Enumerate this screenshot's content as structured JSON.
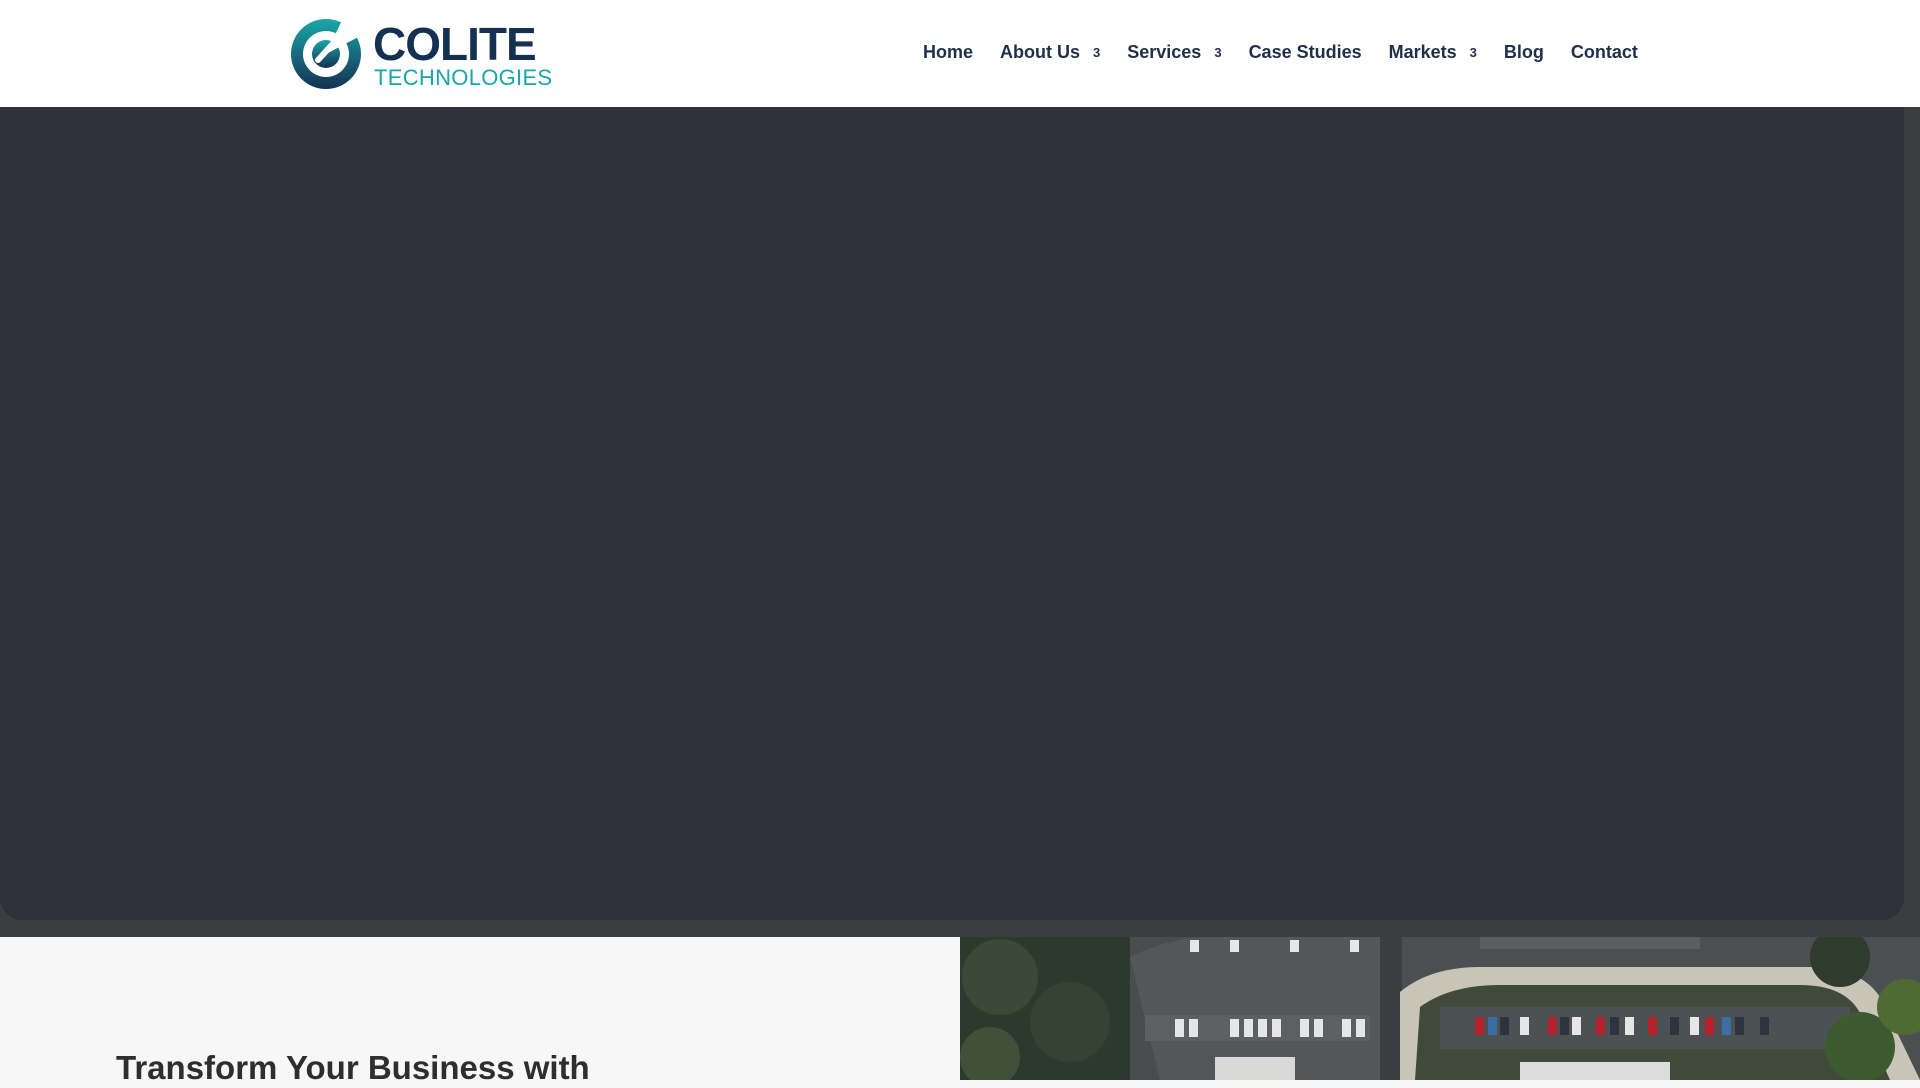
{
  "brand": {
    "name": "COLITE",
    "tagline": "TECHNOLOGIES",
    "colors": {
      "navy": "#143152",
      "teal": "#1aa6a9"
    }
  },
  "nav": {
    "items": [
      {
        "label": "Home",
        "has_dropdown": false
      },
      {
        "label": "About Us",
        "has_dropdown": true
      },
      {
        "label": "Services",
        "has_dropdown": true
      },
      {
        "label": "Case Studies",
        "has_dropdown": false
      },
      {
        "label": "Markets",
        "has_dropdown": true
      },
      {
        "label": "Blog",
        "has_dropdown": false
      },
      {
        "label": "Contact",
        "has_dropdown": false
      }
    ],
    "dropdown_glyph": "3"
  },
  "hero": {
    "background": "#31313b"
  },
  "intro": {
    "heading": "Transform Your Business with"
  },
  "icons": [
    "colite-logo-icon",
    "chevron-down-icon"
  ]
}
